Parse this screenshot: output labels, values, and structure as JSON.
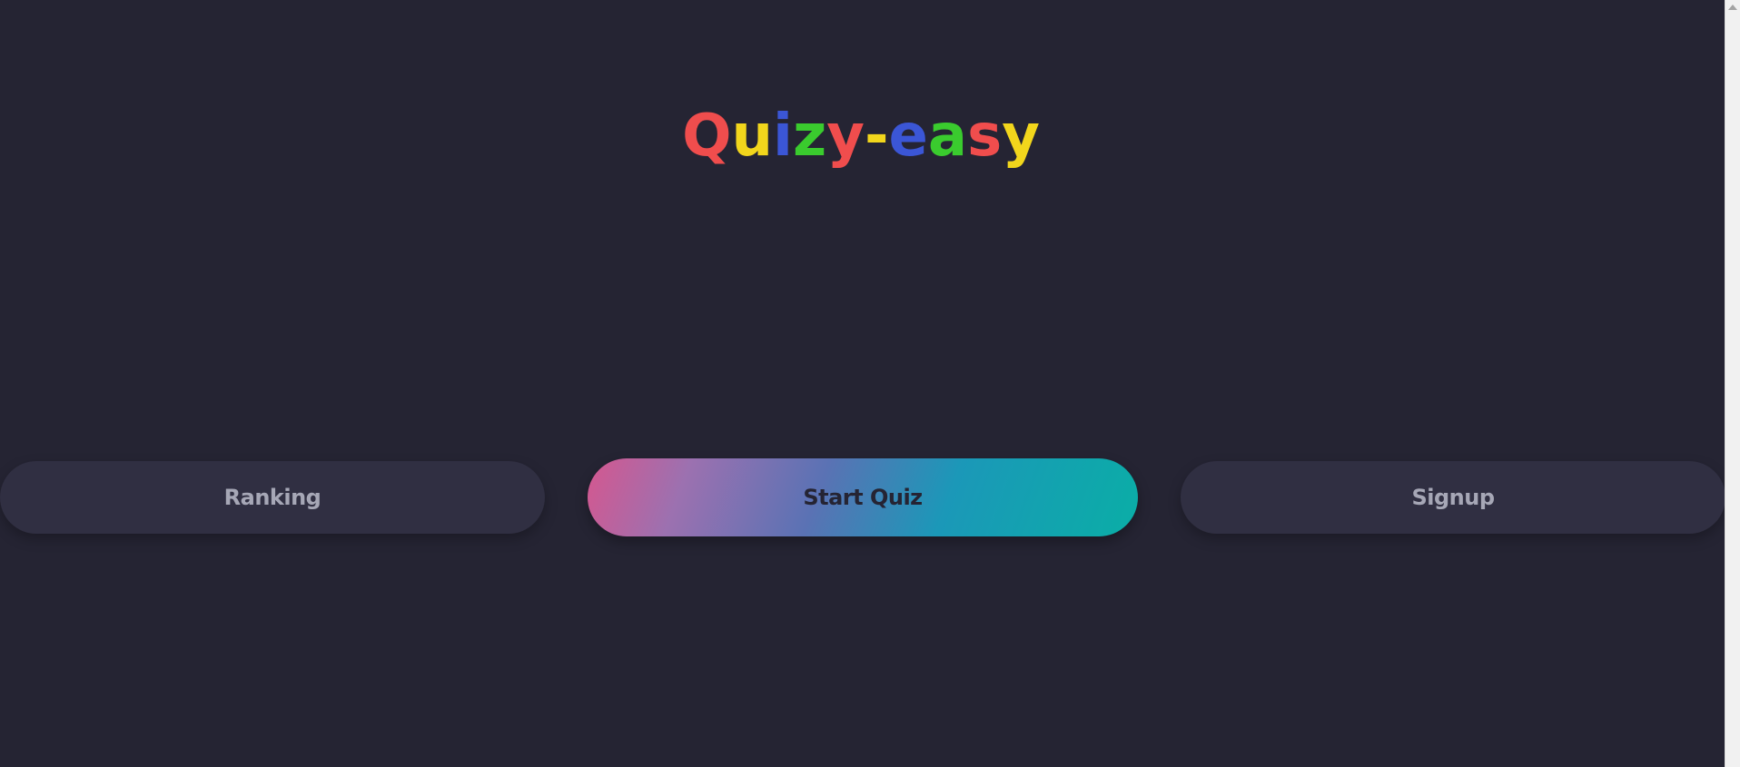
{
  "logo": {
    "letters": [
      {
        "char": "Q",
        "color": "#f04d4d"
      },
      {
        "char": "u",
        "color": "#f2d61c"
      },
      {
        "char": "i",
        "color": "#3b56d6"
      },
      {
        "char": "z",
        "color": "#3acb2e"
      },
      {
        "char": "y",
        "color": "#f04d4d"
      },
      {
        "char": "-",
        "color": "#f2d61c"
      },
      {
        "char": "e",
        "color": "#3b56d6"
      },
      {
        "char": "a",
        "color": "#3acb2e"
      },
      {
        "char": "s",
        "color": "#f04d4d"
      },
      {
        "char": "y",
        "color": "#f2d61c"
      }
    ]
  },
  "buttons": {
    "ranking": "Ranking",
    "start": "Start Quiz",
    "signup": "Signup"
  },
  "colors": {
    "background": "#252433",
    "side_button": "#302f42",
    "side_button_text": "#a6a7b6",
    "gradient_start": "#d5578f",
    "gradient_end": "#0aaea6"
  }
}
